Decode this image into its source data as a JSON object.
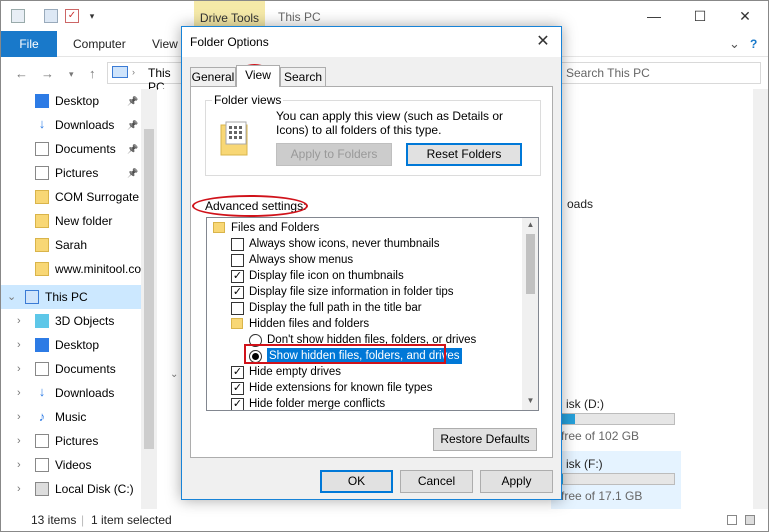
{
  "explorer": {
    "contextual_tab": "Drive Tools",
    "window_title": "This PC",
    "minimize": "—",
    "maximize": "☐",
    "close": "✕",
    "ribbon_tabs": {
      "file": "File",
      "computer": "Computer",
      "view": "View"
    },
    "expand_ribbon": "⌄",
    "help": "?",
    "address_path": "This PC",
    "search_placeholder": "Search This PC",
    "nav_items": [
      {
        "label": "Desktop",
        "icon": "desktop-icon",
        "pinned": true
      },
      {
        "label": "Downloads",
        "icon": "downloads-icon",
        "pinned": true
      },
      {
        "label": "Documents",
        "icon": "documents-icon",
        "pinned": true
      },
      {
        "label": "Pictures",
        "icon": "pictures-icon",
        "pinned": true
      },
      {
        "label": "COM Surrogate",
        "icon": "folder-icon"
      },
      {
        "label": "New folder",
        "icon": "folder-icon"
      },
      {
        "label": "Sarah",
        "icon": "folder-icon"
      },
      {
        "label": "www.minitool.co",
        "icon": "folder-icon"
      },
      {
        "label": "This PC",
        "icon": "this-pc-icon",
        "selected": true
      },
      {
        "label": "3D Objects",
        "icon": "3d-objects-icon"
      },
      {
        "label": "Desktop",
        "icon": "desktop-icon"
      },
      {
        "label": "Documents",
        "icon": "documents-icon"
      },
      {
        "label": "Downloads",
        "icon": "downloads-icon"
      },
      {
        "label": "Music",
        "icon": "music-icon"
      },
      {
        "label": "Pictures",
        "icon": "pictures-icon"
      },
      {
        "label": "Videos",
        "icon": "videos-icon"
      },
      {
        "label": "Local Disk (C:)",
        "icon": "local-disk-icon"
      }
    ],
    "content_fragments": {
      "downloads": "oads",
      "disk_d": "isk (D:)",
      "disk_d_free": "free of 102 GB",
      "disk_f": "isk (F:)",
      "disk_f_free": "free of 17.1 GB"
    },
    "drive_d_usage": 0.12,
    "drive_f_usage": 0.02,
    "status": {
      "items": "13 items",
      "selected": "1 item selected"
    }
  },
  "dialog": {
    "title": "Folder Options",
    "close": "✕",
    "tabs": {
      "general": "General",
      "view": "View",
      "search": "Search"
    },
    "folder_views": {
      "legend": "Folder views",
      "description": "You can apply this view (such as Details or Icons) to all folders of this type.",
      "apply_button": "Apply to Folders",
      "reset_button": "Reset Folders"
    },
    "advanced_label": "Advanced settings:",
    "tree_rows": [
      {
        "label": "Files and Folders",
        "kind": "folder",
        "indent": 0
      },
      {
        "label": "Always show icons, never thumbnails",
        "kind": "checkbox",
        "checked": false,
        "indent": 1
      },
      {
        "label": "Always show menus",
        "kind": "checkbox",
        "checked": false,
        "indent": 1
      },
      {
        "label": "Display file icon on thumbnails",
        "kind": "checkbox",
        "checked": true,
        "indent": 1
      },
      {
        "label": "Display file size information in folder tips",
        "kind": "checkbox",
        "checked": true,
        "indent": 1
      },
      {
        "label": "Display the full path in the title bar",
        "kind": "checkbox",
        "checked": false,
        "indent": 1
      },
      {
        "label": "Hidden files and folders",
        "kind": "folder",
        "indent": 1
      },
      {
        "label": "Don't show hidden files, folders, or drives",
        "kind": "radio",
        "checked": false,
        "indent": 2
      },
      {
        "label": "Show hidden files, folders, and drives",
        "kind": "radio",
        "checked": true,
        "indent": 2,
        "highlighted": true
      },
      {
        "label": "Hide empty drives",
        "kind": "checkbox",
        "checked": true,
        "indent": 1
      },
      {
        "label": "Hide extensions for known file types",
        "kind": "checkbox",
        "checked": true,
        "indent": 1
      },
      {
        "label": "Hide folder merge conflicts",
        "kind": "checkbox",
        "checked": true,
        "indent": 1
      }
    ],
    "restore_button": "Restore Defaults",
    "ok_button": "OK",
    "cancel_button": "Cancel",
    "apply_button": "Apply"
  },
  "colors": {
    "accent": "#0078d7",
    "file_tab": "#1979ca",
    "annotation_red": "#d0121a",
    "contextual_tab": "#f5e9a8"
  }
}
